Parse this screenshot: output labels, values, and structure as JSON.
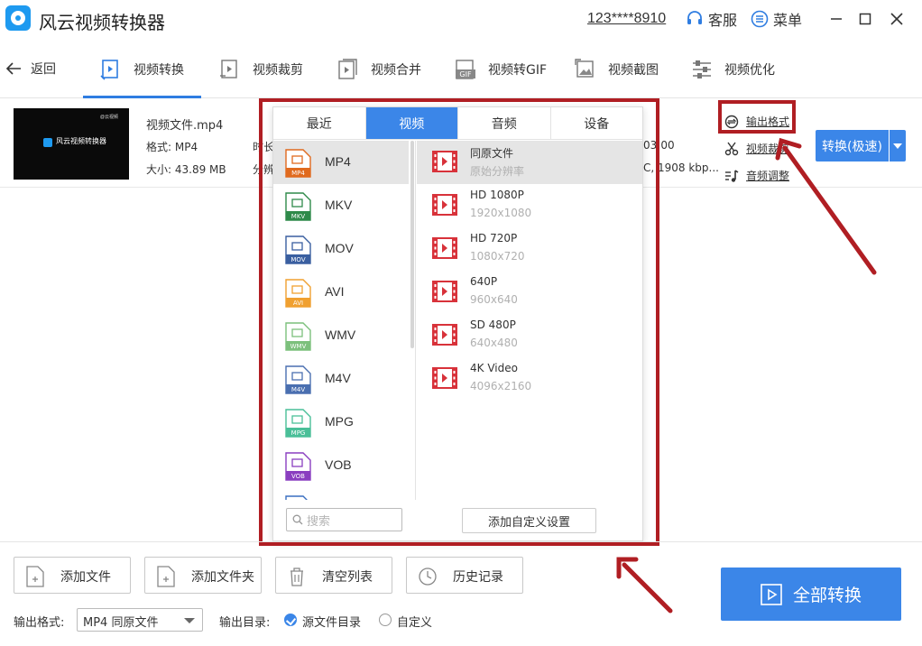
{
  "app": {
    "title": "风云视频转换器",
    "account": "123****8910"
  },
  "titlebar": {
    "service": "客服",
    "menu": "菜单"
  },
  "nav": {
    "back": "返回",
    "tabs": [
      {
        "label": "视频转换",
        "active": true
      },
      {
        "label": "视频裁剪"
      },
      {
        "label": "视频合并"
      },
      {
        "label": "视频转GIF"
      },
      {
        "label": "视频截图"
      },
      {
        "label": "视频优化"
      }
    ]
  },
  "file": {
    "name": "视频文件.mp4",
    "format": "格式: MP4",
    "size": "大小: 43.89 MB",
    "duration_fragment": "时长",
    "resolution_fragment": "分辨",
    "bitrate_fragment": "03:00",
    "codec_fragment": "C, 1908 kbp...",
    "thumb_text": "风云视频转换器",
    "thumb_tag": "@云视频",
    "actions": {
      "output_format": "输出格式",
      "video_crop": "视频裁剪",
      "audio_adjust": "音频调整"
    },
    "convert": "转换(极速)"
  },
  "popup": {
    "tabs": [
      "最近",
      "视频",
      "音频",
      "设备"
    ],
    "active_tab": "视频",
    "formats": [
      "MP4",
      "MKV",
      "MOV",
      "AVI",
      "WMV",
      "M4V",
      "MPG",
      "VOB"
    ],
    "format_colors": [
      "#e06a1e",
      "#2f8a4a",
      "#3a5fa0",
      "#f0a030",
      "#7cc07c",
      "#4a6fb0",
      "#4abf98",
      "#8a3fc0"
    ],
    "presets": [
      {
        "name": "同原文件",
        "res": "原始分辨率"
      },
      {
        "name": "HD 1080P",
        "res": "1920x1080"
      },
      {
        "name": "HD 720P",
        "res": "1080x720"
      },
      {
        "name": "640P",
        "res": "960x640"
      },
      {
        "name": "SD 480P",
        "res": "640x480"
      },
      {
        "name": "4K Video",
        "res": "4096x2160"
      }
    ],
    "search_placeholder": "搜索",
    "custom_button": "添加自定义设置"
  },
  "bottom": {
    "add_file": "添加文件",
    "add_folder": "添加文件夹",
    "clear_list": "清空列表",
    "history": "历史记录",
    "convert_all": "全部转换",
    "output_format_label": "输出格式:",
    "output_format_value": "MP4 同原文件",
    "output_dir_label": "输出目录:",
    "source_dir": "源文件目录",
    "custom_dir": "自定义"
  },
  "colors": {
    "accent": "#3b86e8",
    "annotation_red": "#b01e23"
  }
}
